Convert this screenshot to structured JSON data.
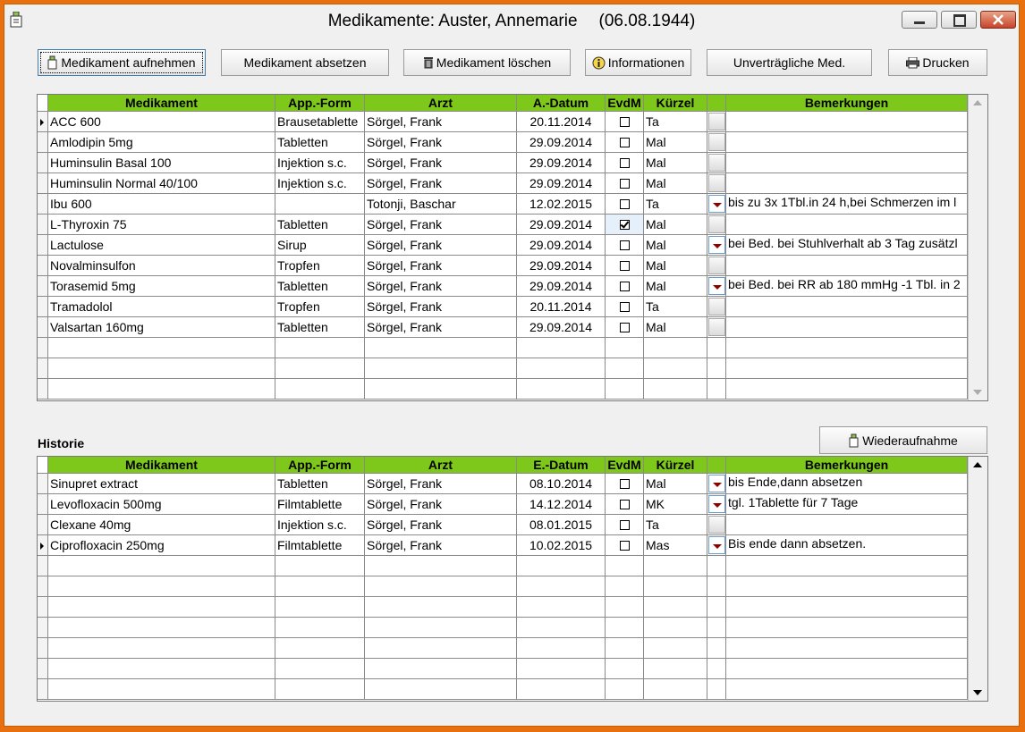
{
  "window": {
    "title_name": "Medikamente: Auster, Annemarie",
    "title_dob": "(06.08.1944)"
  },
  "toolbar": {
    "add": "Medikament aufnehmen",
    "discontinue": "Medikament absetzen",
    "delete": "Medikament löschen",
    "info": "Informationen",
    "incompatible": "Unverträgliche Med.",
    "print": "Drucken"
  },
  "current": {
    "headers": [
      "Medikament",
      "App.-Form",
      "Arzt",
      "A.-Datum",
      "EvdM",
      "Kürzel",
      "",
      "Bemerkungen"
    ],
    "rows": [
      {
        "med": "ACC 600",
        "form": "Brausetablette",
        "doc": "Sörgel, Frank",
        "date": "20.11.2014",
        "evdm": false,
        "code": "Ta",
        "dd": false,
        "note": ""
      },
      {
        "med": "Amlodipin 5mg",
        "form": "Tabletten",
        "doc": "Sörgel, Frank",
        "date": "29.09.2014",
        "evdm": false,
        "code": "Mal",
        "dd": false,
        "note": ""
      },
      {
        "med": "Huminsulin Basal 100",
        "form": "Injektion s.c.",
        "doc": "Sörgel, Frank",
        "date": "29.09.2014",
        "evdm": false,
        "code": "Mal",
        "dd": false,
        "note": ""
      },
      {
        "med": "Huminsulin Normal 40/100",
        "form": "Injektion s.c.",
        "doc": "Sörgel, Frank",
        "date": "29.09.2014",
        "evdm": false,
        "code": "Mal",
        "dd": false,
        "note": ""
      },
      {
        "med": "Ibu 600",
        "form": "",
        "doc": "Totonji, Baschar",
        "date": "12.02.2015",
        "evdm": false,
        "code": "Ta",
        "dd": true,
        "note": "bis zu 3x 1Tbl.in 24 h,bei Schmerzen im l"
      },
      {
        "med": "L-Thyroxin 75",
        "form": "Tabletten",
        "doc": "Sörgel, Frank",
        "date": "29.09.2014",
        "evdm": true,
        "code": "Mal",
        "dd": false,
        "note": ""
      },
      {
        "med": "Lactulose",
        "form": "Sirup",
        "doc": "Sörgel, Frank",
        "date": "29.09.2014",
        "evdm": false,
        "code": "Mal",
        "dd": true,
        "note": "bei Bed. bei Stuhlverhalt ab 3 Tag zusätzl"
      },
      {
        "med": "Novalminsulfon",
        "form": "Tropfen",
        "doc": "Sörgel, Frank",
        "date": "29.09.2014",
        "evdm": false,
        "code": "Mal",
        "dd": false,
        "note": ""
      },
      {
        "med": "Torasemid 5mg",
        "form": "Tabletten",
        "doc": "Sörgel, Frank",
        "date": "29.09.2014",
        "evdm": false,
        "code": "Mal",
        "dd": true,
        "note": "bei Bed. bei RR ab  180 mmHg -1 Tbl. in 2"
      },
      {
        "med": "Tramadolol",
        "form": "Tropfen",
        "doc": "Sörgel, Frank",
        "date": "20.11.2014",
        "evdm": false,
        "code": "Ta",
        "dd": false,
        "note": ""
      },
      {
        "med": "Valsartan 160mg",
        "form": "Tabletten",
        "doc": "Sörgel, Frank",
        "date": "29.09.2014",
        "evdm": false,
        "code": "Mal",
        "dd": false,
        "note": ""
      }
    ]
  },
  "history": {
    "label": "Historie",
    "reactivate": "Wiederaufnahme",
    "headers": [
      "Medikament",
      "App.-Form",
      "Arzt",
      "E.-Datum",
      "EvdM",
      "Kürzel",
      "",
      "Bemerkungen"
    ],
    "rows": [
      {
        "med": "Sinupret extract",
        "form": "Tabletten",
        "doc": "Sörgel, Frank",
        "date": "08.10.2014",
        "evdm": false,
        "code": "Mal",
        "dd": true,
        "note": "bis Ende,dann absetzen"
      },
      {
        "med": "Levofloxacin 500mg",
        "form": "Filmtablette",
        "doc": "Sörgel, Frank",
        "date": "14.12.2014",
        "evdm": false,
        "code": "MK",
        "dd": true,
        "note": "tgl. 1Tablette für 7 Tage"
      },
      {
        "med": "Clexane 40mg",
        "form": "Injektion s.c.",
        "doc": "Sörgel, Frank",
        "date": "08.01.2015",
        "evdm": false,
        "code": "Ta",
        "dd": false,
        "note": ""
      },
      {
        "med": "Ciprofloxacin 250mg",
        "form": "Filmtablette",
        "doc": "Sörgel, Frank",
        "date": "10.02.2015",
        "evdm": false,
        "code": "Mas",
        "dd": true,
        "note": "Bis ende dann absetzen."
      }
    ]
  },
  "colors": {
    "header_bg": "#7ec81c",
    "frame": "#e8700f"
  },
  "icons": [
    "app-icon",
    "add-med-icon",
    "trash-icon",
    "info-icon",
    "printer-icon",
    "reactivate-icon"
  ]
}
